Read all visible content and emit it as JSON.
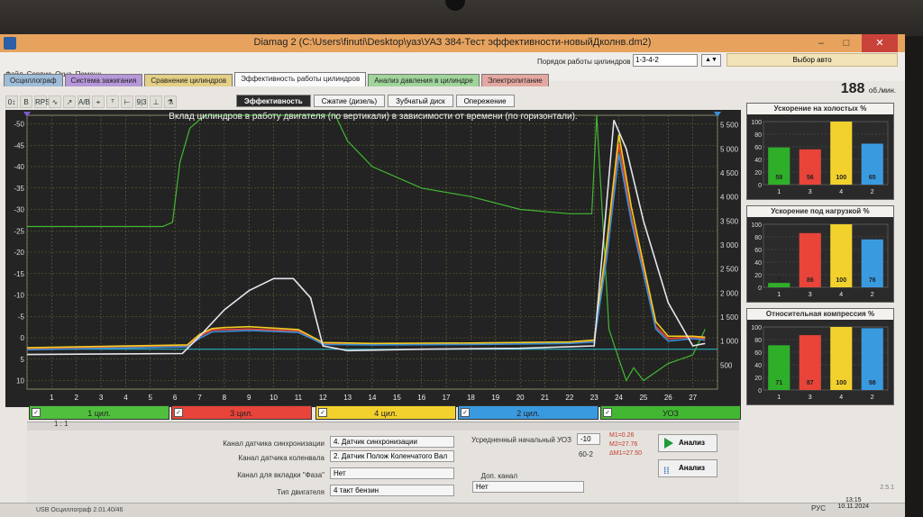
{
  "window": {
    "title": "Diamag 2 (C:\\Users\\finuti\\Desktop\\уаз\\УАЗ 384-Тест эффективности-новыйДколнв.dm2)",
    "min": "–",
    "max": "□",
    "close": "✕"
  },
  "menu": [
    "Файл",
    "Сервис",
    "Окна",
    "Помощь"
  ],
  "firing_order": {
    "label": "Порядок работы цилиндров",
    "value": "1-3-4-2",
    "auto_label": "Выбор авто"
  },
  "main_tabs": [
    {
      "label": "Осциллограф",
      "color": "#9fbcd9"
    },
    {
      "label": "Система зажигания",
      "color": "#b697d9"
    },
    {
      "label": "Сравнение цилиндров",
      "color": "#e3cf85"
    },
    {
      "label": "Эффективность работы цилиндров",
      "color": "#fafafa",
      "active": true
    },
    {
      "label": "Анализ давления в цилиндре",
      "color": "#9fd49a"
    },
    {
      "label": "Электропитание",
      "color": "#e4a8a2"
    }
  ],
  "rpm": {
    "value": "188",
    "unit": "об./мин."
  },
  "toolbar_icons": [
    "scale-icon",
    "bold-icon",
    "rps-icon",
    "wave-icon",
    "line-icon",
    "ab-icon",
    "tree-icon",
    "fft-icon",
    "marker-icon",
    "nine-icon",
    "cursor-icon",
    "filter-icon"
  ],
  "toolbar_glyphs": [
    "0↕",
    "B",
    "RPS",
    "∿",
    "↗",
    "A/B",
    "⌖",
    "ᵀ",
    "⊢",
    "9|3",
    "⊥",
    "⚗"
  ],
  "sub_tabs": [
    {
      "label": "Эффективность",
      "active": true
    },
    {
      "label": "Сжатие (дизель)"
    },
    {
      "label": "Зубчатый диск"
    },
    {
      "label": "Опережение"
    }
  ],
  "chart_data": {
    "type": "line",
    "title": "Вклад цилиндров в работу двигателя (по вертикали) в зависимости от времени (по горизонтали).",
    "x_ticks": [
      1,
      2,
      3,
      4,
      5,
      6,
      7,
      8,
      9,
      10,
      11,
      12,
      13,
      14,
      15,
      16,
      17,
      18,
      19,
      20,
      21,
      22,
      23,
      24,
      25,
      26,
      27
    ],
    "y_left_ticks": [
      "-50",
      "-45",
      "-40",
      "-35",
      "-30",
      "-25",
      "-20",
      "-15",
      "-10",
      "-5",
      "0",
      "5",
      "10"
    ],
    "y_right_ticks": [
      "5 500",
      "5 000",
      "4 500",
      "4 000",
      "3 500",
      "3 000",
      "2 500",
      "2 000",
      "1 500",
      "1 000",
      "500"
    ],
    "xlim": [
      0,
      28
    ],
    "ylim_left": [
      -52,
      12
    ],
    "ylim_right": [
      0,
      5700
    ],
    "series": [
      {
        "name": "УОЗ",
        "axis": "left",
        "color": "#42b832",
        "x": [
          0,
          5.5,
          5.9,
          6.2,
          6.6,
          7.2,
          8,
          10,
          11,
          11.7,
          12,
          12.5,
          13,
          14,
          16,
          18,
          20,
          22,
          22.9,
          23.1,
          23.6,
          24,
          24.3,
          24.6,
          25,
          25.5,
          26,
          26.5,
          27,
          27.5
        ],
        "y": [
          -26,
          -26,
          -27,
          -41,
          -49,
          -52,
          -52,
          -52,
          -52,
          -52,
          -52,
          -52,
          -46,
          -40,
          -35,
          -33,
          -30,
          -29,
          -29,
          -52,
          -2,
          5,
          10,
          7,
          10,
          8,
          6,
          5,
          4,
          -2
        ]
      },
      {
        "name": "3 цил.",
        "axis": "right",
        "color": "#e8443a",
        "x": [
          0,
          6.5,
          7,
          7.5,
          8,
          9,
          10,
          11,
          11.6,
          12,
          14,
          18,
          22,
          23,
          23.5,
          24,
          24.5,
          25,
          25.5,
          26,
          27,
          27.5
        ],
        "y": [
          840,
          900,
          1100,
          1230,
          1240,
          1250,
          1230,
          1210,
          1060,
          950,
          940,
          950,
          970,
          1000,
          2800,
          5100,
          3600,
          2500,
          1300,
          1050,
          1080,
          1050
        ]
      },
      {
        "name": "4 цил.",
        "axis": "right",
        "color": "#f2cd20",
        "x": [
          0,
          6.5,
          7,
          7.5,
          8,
          9,
          10,
          11,
          11.6,
          12,
          14,
          18,
          22,
          23,
          23.5,
          24,
          24.5,
          25,
          25.5,
          26,
          27,
          27.5
        ],
        "y": [
          860,
          920,
          1140,
          1260,
          1280,
          1300,
          1270,
          1240,
          1080,
          970,
          950,
          960,
          980,
          1020,
          3000,
          5300,
          3800,
          2600,
          1400,
          1100,
          1100,
          1080
        ]
      },
      {
        "name": "2 цил.",
        "axis": "right",
        "color": "#3b8fd6",
        "x": [
          0,
          6.5,
          7,
          7.5,
          8,
          9,
          10,
          11,
          11.6,
          12,
          14,
          18,
          22,
          23,
          23.5,
          24,
          24.5,
          25,
          25.5,
          26,
          27,
          27.5
        ],
        "y": [
          820,
          880,
          1060,
          1190,
          1200,
          1220,
          1200,
          1180,
          1040,
          930,
          920,
          930,
          950,
          980,
          2700,
          4900,
          3500,
          2400,
          1250,
          1000,
          1050,
          1020
        ]
      },
      {
        "name": "1 цил.",
        "axis": "right",
        "color": "#e4e4ec",
        "x": [
          0,
          6.3,
          7,
          8,
          9,
          10,
          10.8,
          11.5,
          12,
          13,
          16,
          20,
          23,
          23.8,
          24.3,
          25,
          26,
          27,
          27.5
        ],
        "y": [
          720,
          740,
          1100,
          1650,
          2050,
          2300,
          2300,
          1900,
          900,
          800,
          830,
          850,
          900,
          5600,
          5000,
          3500,
          1800,
          900,
          950
        ]
      }
    ]
  },
  "cyl_bars": [
    {
      "label": "1 цил.",
      "color": "#4fbf3d"
    },
    {
      "label": "3 цил.",
      "color": "#e8443a"
    },
    {
      "label": "4 цил.",
      "color": "#f2d12d"
    },
    {
      "label": "2 цил.",
      "color": "#3a9ae0"
    },
    {
      "label": "УОЗ",
      "color": "#42b832"
    }
  ],
  "scale": "1 : 1",
  "controls": {
    "sync_label": "Канал датчика синхронизации",
    "sync_value": "4. Датчик синхронизации",
    "crank_label": "Канал датчика коленвала",
    "crank_value": "2. Датчик Полож Коленчатого Вал",
    "phase_label": "Канал для вкладки \"Фаза\"",
    "phase_value": "Нет",
    "engine_label": "Тип двигателя",
    "engine_value": "4 такт бензин",
    "avg_label": "Усредненный начальный УОЗ",
    "avg_value": "-10",
    "avg_sub": "60-2",
    "extra_label": "Доп. канал",
    "extra_value": "Нет",
    "m1": "M1=0.26",
    "m2": "M2=27.76",
    "dm": "ΔM1=27.50",
    "analyze": "Анализ",
    "analyze2": "Анализ",
    "version": "2.5.1"
  },
  "side_charts": [
    {
      "title": "Ускорение на холостых %",
      "labels": [
        "1",
        "3",
        "4",
        "2"
      ],
      "values": [
        59,
        56,
        100,
        65
      ],
      "colors": [
        "#2fae2a",
        "#e8443a",
        "#f2d12d",
        "#3a9ae0"
      ],
      "ticks": [
        "100",
        "80",
        "60",
        "40",
        "20",
        "0"
      ]
    },
    {
      "title": "Ускорение под нагрузкой %",
      "labels": [
        "1",
        "3",
        "4",
        "2"
      ],
      "values": [
        7,
        86,
        100,
        76
      ],
      "colors": [
        "#2fae2a",
        "#e8443a",
        "#f2d12d",
        "#3a9ae0"
      ],
      "ticks": [
        "100",
        "80",
        "60",
        "40",
        "20",
        "0"
      ]
    },
    {
      "title": "Относительная компрессия %",
      "labels": [
        "1",
        "3",
        "4",
        "2"
      ],
      "values": [
        71,
        87,
        100,
        98
      ],
      "colors": [
        "#2fae2a",
        "#e8443a",
        "#f2d12d",
        "#3a9ae0"
      ],
      "ticks": [
        "100",
        "80",
        "60",
        "40",
        "20",
        "0"
      ]
    }
  ],
  "status": {
    "text": "USB Осциллограф   2.01.40/46",
    "time": "13:15",
    "date": "10.11.2024",
    "lang": "РУС"
  }
}
